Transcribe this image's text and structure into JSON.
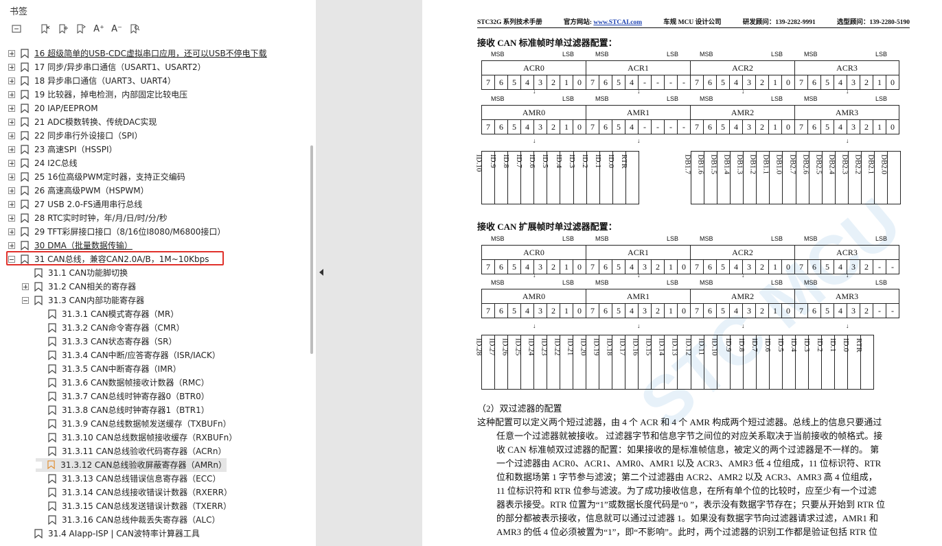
{
  "panel": {
    "title": "书签"
  },
  "toolbar": {
    "icons": [
      "list-icon",
      "delete-bookmark-icon",
      "add-bookmark-icon",
      "bookmark-icon",
      "font-larger-icon",
      "font-smaller-icon",
      "bookmark-search-icon"
    ],
    "font_larger": "A⁺",
    "font_smaller": "A⁻"
  },
  "tree": [
    {
      "label": "16  超级简单的USB-CDC虚拟串口应用，还可以USB不停电下载",
      "level": 0,
      "exp": "plus",
      "under": true
    },
    {
      "label": "17  同步/异步串口通信（USART1、USART2）",
      "level": 0,
      "exp": "plus"
    },
    {
      "label": "18  异步串口通信（UART3、UART4）",
      "level": 0,
      "exp": "plus"
    },
    {
      "label": "19  比较器，掉电检测，内部固定比较电压",
      "level": 0,
      "exp": "plus"
    },
    {
      "label": "20  IAP/EEPROM",
      "level": 0,
      "exp": "plus"
    },
    {
      "label": "21  ADC模数转换、传统DAC实现",
      "level": 0,
      "exp": "plus"
    },
    {
      "label": "22  同步串行外设接口（SPI）",
      "level": 0,
      "exp": "plus"
    },
    {
      "label": "23  高速SPI（HSSPI）",
      "level": 0,
      "exp": "plus"
    },
    {
      "label": "24  I2C总线",
      "level": 0,
      "exp": "plus"
    },
    {
      "label": "25  16位高级PWM定时器，支持正交编码",
      "level": 0,
      "exp": "plus"
    },
    {
      "label": "26  高速高级PWM（HSPWM）",
      "level": 0,
      "exp": "plus"
    },
    {
      "label": "27  USB 2.0-FS通用串行总线",
      "level": 0,
      "exp": "plus"
    },
    {
      "label": "28  RTC实时时钟，年/月/日/时/分/秒",
      "level": 0,
      "exp": "plus"
    },
    {
      "label": "29  TFT彩屏接口接口（8/16位I8080/M6800接口）",
      "level": 0,
      "exp": "plus"
    },
    {
      "label": "30  DMA（批量数据传输）",
      "level": 0,
      "exp": "plus",
      "under": true
    },
    {
      "label": "31  CAN总线，兼容CAN2.0A/B，1M~10Kbps",
      "level": 0,
      "exp": "minus"
    },
    {
      "label": "31.1  CAN功能脚切换",
      "level": 1,
      "exp": "none"
    },
    {
      "label": "31.2  CAN相关的寄存器",
      "level": 1,
      "exp": "plus"
    },
    {
      "label": "31.3  CAN内部功能寄存器",
      "level": 1,
      "exp": "minus"
    },
    {
      "label": "31.3.1  CAN模式寄存器（MR）",
      "level": 2,
      "exp": "none"
    },
    {
      "label": "31.3.2 CAN命令寄存器（CMR）",
      "level": 2,
      "exp": "none"
    },
    {
      "label": "31.3.3  CAN状态寄存器（SR）",
      "level": 2,
      "exp": "none"
    },
    {
      "label": "31.3.4  CAN中断/应答寄存器（ISR/IACK）",
      "level": 2,
      "exp": "none"
    },
    {
      "label": "31.3.5  CAN中断寄存器（IMR）",
      "level": 2,
      "exp": "none"
    },
    {
      "label": "31.3.6 CAN数据帧接收计数器（RMC）",
      "level": 2,
      "exp": "none"
    },
    {
      "label": "31.3.7  CAN总线时钟寄存器0（BTR0）",
      "level": 2,
      "exp": "none"
    },
    {
      "label": "31.3.8 CAN总线时钟寄存器1（BTR1）",
      "level": 2,
      "exp": "none"
    },
    {
      "label": "31.3.9 CAN总线数据帧发送缓存（TXBUFn）",
      "level": 2,
      "exp": "none"
    },
    {
      "label": "31.3.10  CAN总线数据帧接收缓存（RXBUFn）",
      "level": 2,
      "exp": "none"
    },
    {
      "label": "31.3.11 CAN总线验收代码寄存器（ACRn）",
      "level": 2,
      "exp": "none"
    },
    {
      "label": "31.3.12 CAN总线验收屏蔽寄存器（AMRn）",
      "level": 2,
      "exp": "none",
      "sel": true
    },
    {
      "label": "31.3.13  CAN总线错误信息寄存器（ECC）",
      "level": 2,
      "exp": "none"
    },
    {
      "label": "31.3.14 CAN总线接收错误计数器（RXERR）",
      "level": 2,
      "exp": "none"
    },
    {
      "label": "31.3.15 CAN总线发送错误计数器（TXERR）",
      "level": 2,
      "exp": "none"
    },
    {
      "label": "31.3.16  CAN总线仲裁丢失寄存器（ALC）",
      "level": 2,
      "exp": "none"
    },
    {
      "label": "31.4  AIapp-ISP | CAN波特率计算器工具",
      "level": 1,
      "exp": "none"
    }
  ],
  "doc": {
    "header": {
      "left": "STC32G 系列技术手册",
      "site_label": "官方网站:",
      "site_url": "www.STCAI.com",
      "company": "车规 MCU 设计公司",
      "dev": "研发顾问：139-2282-9991",
      "sel": "选型顾问：139-2280-5190"
    },
    "sec1_title": "接收 CAN 标准帧时单过滤器配置：",
    "sec2_title": "接收 CAN 扩展帧时单过滤器配置：",
    "msb": "MSB",
    "lsb": "LSB",
    "arrow": "↓",
    "std_acr": [
      "ACR0",
      "ACR1",
      "ACR2",
      "ACR3"
    ],
    "std_amr": [
      "AMR0",
      "AMR1",
      "AMR2",
      "AMR3"
    ],
    "std_bits": [
      [
        "7",
        "6",
        "5",
        "4",
        "3",
        "2",
        "1",
        "0"
      ],
      [
        "7",
        "6",
        "5",
        "4",
        "-",
        "-",
        "-",
        "-"
      ],
      [
        "7",
        "6",
        "5",
        "4",
        "3",
        "2",
        "1",
        "0"
      ],
      [
        "7",
        "6",
        "5",
        "4",
        "3",
        "2",
        "1",
        "0"
      ]
    ],
    "ext_bits": [
      [
        "7",
        "6",
        "5",
        "4",
        "3",
        "2",
        "1",
        "0"
      ],
      [
        "7",
        "6",
        "5",
        "4",
        "3",
        "2",
        "1",
        "0"
      ],
      [
        "7",
        "6",
        "5",
        "4",
        "3",
        "2",
        "1",
        "0"
      ],
      [
        "7",
        "6",
        "5",
        "4",
        "3",
        "2",
        "-",
        "-"
      ]
    ],
    "std_ids_a": [
      "ID.10",
      "ID.9",
      "ID.8",
      "ID.7",
      "ID.6",
      "ID.5",
      "ID.4",
      "ID.3",
      "ID.2",
      "ID.1",
      "ID.0",
      "RTR"
    ],
    "std_ids_b": [
      "DB1.7",
      "DB1.6",
      "DB1.5",
      "DB1.4",
      "DB1.3",
      "DB1.2",
      "DB1.1",
      "DB1.0",
      "DB2.7",
      "DB2.6",
      "DB2.5",
      "DB2.4",
      "DB2.3",
      "DB2.2",
      "DB2.1",
      "DB2.0"
    ],
    "ext_ids": [
      "ID.28",
      "ID.27",
      "ID.26",
      "ID.25",
      "ID.24",
      "ID.23",
      "ID.22",
      "ID.21",
      "ID.20",
      "ID.19",
      "ID.18",
      "ID.17",
      "ID.16",
      "ID.15",
      "ID.14",
      "ID.13",
      "ID.12",
      "ID.11",
      "ID.10",
      "ID.9",
      "ID.8",
      "ID.7",
      "ID.6",
      "ID.5",
      "ID.4",
      "ID.3",
      "ID.2",
      "ID.1",
      "ID.0",
      "RTR"
    ],
    "para_head": "（2）双过滤器的配置",
    "para_lines": [
      "这种配置可以定义两个短过滤器，由 4 个 ACR 和 4 个 AMR 构成两个短过滤器。总线上的信息只要通过",
      "任意一个过滤器就被接收。 过滤器字节和信息字节之间位的对应关系取决于当前接收的帧格式。接",
      "收 CAN 标准帧双过滤器的配置：如果接收的是标准帧信息，被定义的两个过滤器是不一样的。 第",
      "一个过滤器由 ACR0、ACR1、AMR0、AMR1 以及 ACR3、AMR3 低 4 位组成，11 位标识符、RTR",
      "位和数据场第 1 字节参与滤波；第二个过滤器由 ACR2、AMR2 以及 ACR3、AMR3 高 4 位组成，",
      "11 位标识符和 RTR 位参与滤波。为了成功接收信息，在所有单个位的比较时，应至少有一个过滤",
      "器表示接受。RTR 位置为“1”或数据长度代码是“0 ”，表示没有数据字节存在；只要从开始到 RTR 位",
      "的部分都被表示接收，信息就可以通过过滤器 1。如果没有数据字节向过滤器请求过滤，AMR1 和",
      "AMR3 的低 4 位必须被置为“1”，即“不影响”。此时，两个过滤器的识别工作都是验证包括 RTR 位"
    ],
    "watermark": "STC MCU"
  }
}
